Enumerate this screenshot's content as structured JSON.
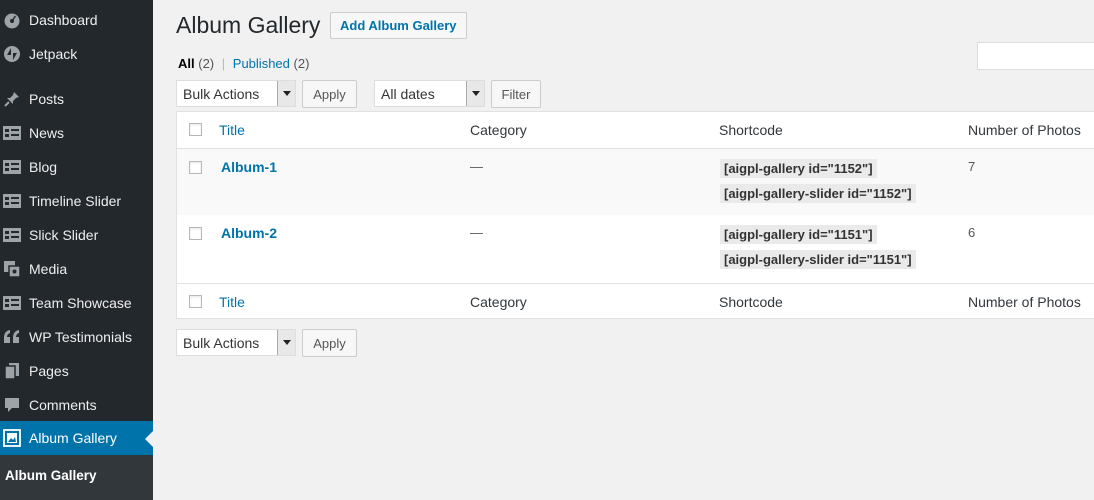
{
  "sidebar": {
    "items": [
      {
        "label": "Dashboard",
        "icon": "dashboard-icon"
      },
      {
        "label": "Jetpack",
        "icon": "jetpack-icon"
      },
      {
        "label": "Posts",
        "icon": "pin-icon"
      },
      {
        "label": "News",
        "icon": "list-icon"
      },
      {
        "label": "Blog",
        "icon": "list-icon"
      },
      {
        "label": "Timeline Slider",
        "icon": "list-icon"
      },
      {
        "label": "Slick Slider",
        "icon": "list-icon"
      },
      {
        "label": "Media",
        "icon": "media-icon"
      },
      {
        "label": "Team Showcase",
        "icon": "list-icon"
      },
      {
        "label": "WP Testimonials",
        "icon": "quote-icon"
      },
      {
        "label": "Pages",
        "icon": "pages-icon"
      },
      {
        "label": "Comments",
        "icon": "comment-icon"
      },
      {
        "label": "Album Gallery",
        "icon": "gallery-icon"
      }
    ],
    "submenu": {
      "current": "Album Gallery"
    }
  },
  "page": {
    "title": "Album Gallery",
    "add_button": "Add Album Gallery"
  },
  "filters": {
    "all_label": "All",
    "all_count": "(2)",
    "separator": "|",
    "published_label": "Published",
    "published_count": "(2)"
  },
  "toolbar": {
    "bulk_actions": "Bulk Actions",
    "apply": "Apply",
    "dates": "All dates",
    "filter": "Filter"
  },
  "table": {
    "columns": [
      "Title",
      "Category",
      "Shortcode",
      "Number of Photos"
    ],
    "rows": [
      {
        "title": "Album-1",
        "category": "—",
        "shortcode_gallery": "[aigpl-gallery id=\"1152\"]",
        "shortcode_slider": "[aigpl-gallery-slider id=\"1152\"]",
        "photos": "7"
      },
      {
        "title": "Album-2",
        "category": "—",
        "shortcode_gallery": "[aigpl-gallery id=\"1151\"]",
        "shortcode_slider": "[aigpl-gallery-slider id=\"1151\"]",
        "photos": "6"
      }
    ]
  },
  "colors": {
    "accent": "#0073aa",
    "sidebar": "#23282d",
    "background": "#f1f1f1"
  }
}
